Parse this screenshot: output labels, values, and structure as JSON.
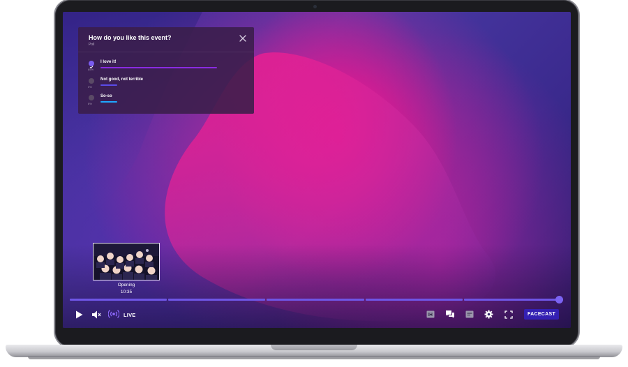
{
  "poll": {
    "title": "How do you like this event?",
    "subtitle": "Poll",
    "options": [
      {
        "label": "I love it!",
        "percent": "85%",
        "share": 0.85,
        "color": "#8a2be2",
        "selected": true
      },
      {
        "label": "Not good, not terrible",
        "percent": "0%",
        "share": 0.12,
        "color": "#5b4be8",
        "selected": false
      },
      {
        "label": "So-so",
        "percent": "8%",
        "share": 0.12,
        "color": "#1fa8ff",
        "selected": false
      }
    ]
  },
  "chapter": {
    "name": "Opening",
    "time": "10:35"
  },
  "player": {
    "live_label": "LIVE",
    "brand": "FACECAST",
    "progress": 1.0,
    "segments": 5
  },
  "icons": {
    "play": "play-icon",
    "volume": "volume-icon",
    "live": "live-broadcast-icon",
    "subtitles": "subtitles-icon",
    "chat": "chat-icon",
    "captions": "captions-icon",
    "settings": "gear-icon",
    "fullscreen": "fullscreen-icon",
    "close": "close-icon"
  },
  "colors": {
    "accent": "#6f56e6",
    "brand_bg": "#3420b3"
  }
}
